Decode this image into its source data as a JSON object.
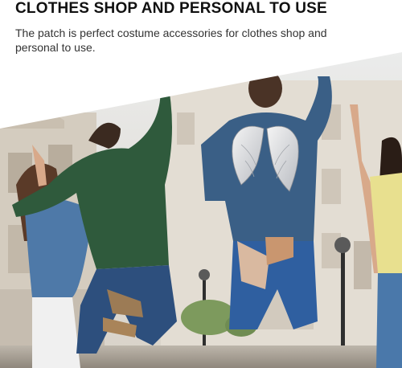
{
  "banner": {
    "headline": "CLOTHES SHOP AND PERSONAL TO USE",
    "description": "The patch is perfect costume accessories for clothes shop and personal to use."
  },
  "photo": {
    "subject": "people-jumping-street",
    "featured_product": "angel-wings-patch-icon"
  },
  "colors": {
    "background": "#ffffff",
    "headline_text": "#111111",
    "body_text": "#333333",
    "street_tone": "#d9d2c8",
    "green_shirt": "#2f5a3c",
    "blue_shirt": "#3a5f86",
    "denim": "#2d4f7d"
  }
}
